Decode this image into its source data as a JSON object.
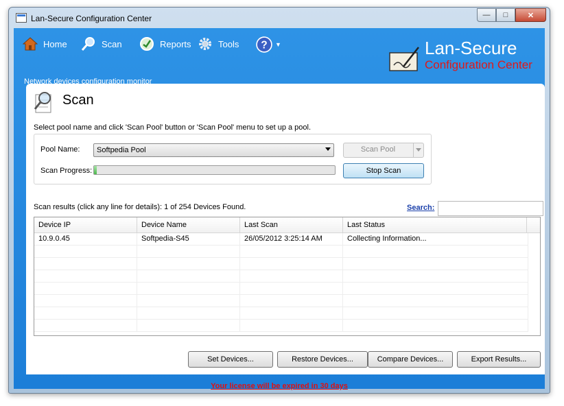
{
  "window": {
    "title": "Lan-Secure Configuration Center"
  },
  "menu": {
    "home": "Home",
    "scan": "Scan",
    "reports": "Reports",
    "tools": "Tools"
  },
  "subtitle": "Network devices configuration monitor",
  "brand": {
    "line1": "Lan-Secure",
    "line2": "Configuration Center"
  },
  "page": {
    "title": "Scan",
    "intro": "Select pool name and click 'Scan Pool' button or 'Scan Pool' menu to set up a pool."
  },
  "pool": {
    "name_label": "Pool Name:",
    "selected": "Softpedia Pool",
    "progress_label": "Scan Progress:",
    "progress": 0.01,
    "scan_pool_button": "Scan Pool",
    "stop_scan_button": "Stop Scan"
  },
  "results": {
    "label": "Scan results (click any line for details):  1 of 254 Devices Found.",
    "search_link": "Search:",
    "search_value": ""
  },
  "table": {
    "headers": [
      "Device IP",
      "Device Name",
      "Last Scan",
      "Last Status"
    ],
    "rows": [
      [
        "10.9.0.45",
        "Softpedia-S45",
        "26/05/2012 3:25:14 AM",
        "Collecting Information..."
      ]
    ]
  },
  "buttons": {
    "set_devices": "Set Devices...",
    "restore_devices": "Restore Devices...",
    "compare_devices": "Compare Devices...",
    "export_results": "Export Results..."
  },
  "license": "Your license will be expired in 30 days",
  "colors": {
    "chrome_blue": "#2a8be0",
    "brand_red": "#e01818",
    "progress_green": "#4db84d"
  }
}
